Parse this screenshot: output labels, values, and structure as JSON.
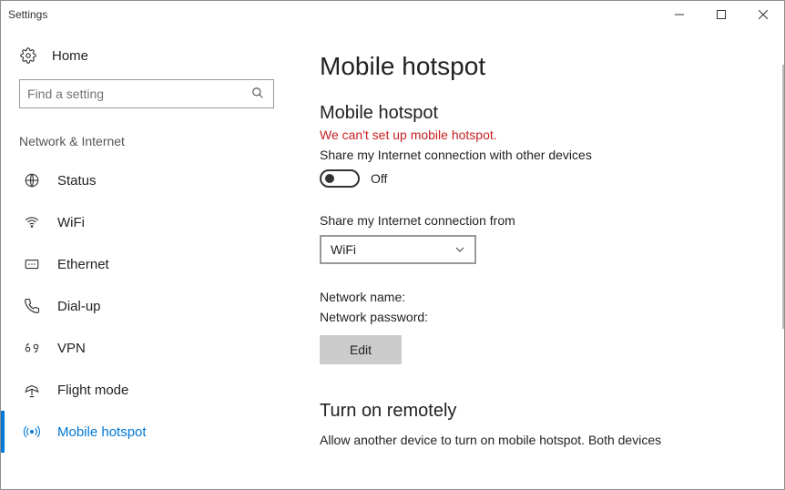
{
  "window": {
    "title": "Settings"
  },
  "sidebar": {
    "home": "Home",
    "search_placeholder": "Find a setting",
    "category": "Network & Internet",
    "items": [
      {
        "label": "Status"
      },
      {
        "label": "WiFi"
      },
      {
        "label": "Ethernet"
      },
      {
        "label": "Dial-up"
      },
      {
        "label": "VPN"
      },
      {
        "label": "Flight mode"
      },
      {
        "label": "Mobile hotspot"
      }
    ]
  },
  "content": {
    "page_title": "Mobile hotspot",
    "section_title": "Mobile hotspot",
    "error": "We can't set up mobile hotspot.",
    "share_desc": "Share my Internet connection with other devices",
    "toggle_state": "Off",
    "share_from_label": "Share my Internet connection from",
    "share_from_value": "WiFi",
    "network_name_label": "Network name:",
    "network_password_label": "Network password:",
    "edit_label": "Edit",
    "remote_title": "Turn on remotely",
    "remote_desc": "Allow another device to turn on mobile hotspot. Both devices"
  }
}
